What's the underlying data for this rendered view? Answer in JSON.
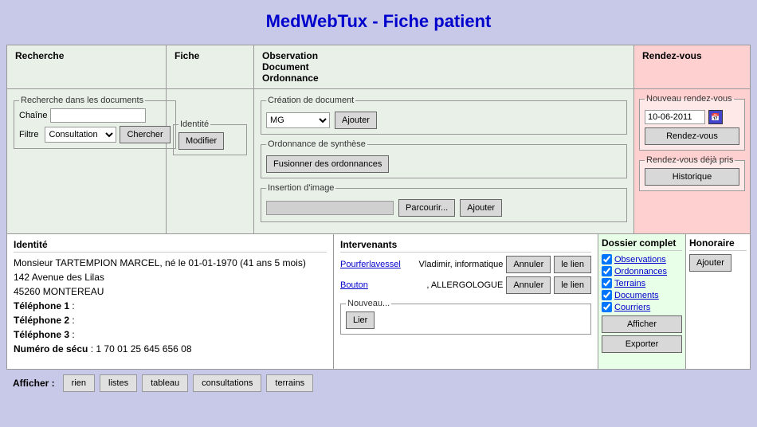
{
  "header": {
    "title": "MedWebTux - Fiche patient"
  },
  "nav": {
    "recherche": "Recherche",
    "fiche": "Fiche",
    "observation": "Observation",
    "document": "Document",
    "ordonnance": "Ordonnance",
    "rendezvous": "Rendez-vous"
  },
  "recherche": {
    "fieldset_label": "Recherche dans les documents",
    "chaine_label": "Chaîne",
    "chaine_value": "",
    "filtre_label": "Filtre",
    "filtre_options": [
      "Consultation"
    ],
    "filtre_selected": "Consultation",
    "chercher_btn": "Chercher"
  },
  "fiche": {
    "identite_label": "Identité",
    "modifier_btn": "Modifier"
  },
  "creation_document": {
    "fieldset_label": "Création de document",
    "type_options": [
      "MG"
    ],
    "type_selected": "MG",
    "ajouter_btn": "Ajouter"
  },
  "ordonnance_synthese": {
    "fieldset_label": "Ordonnance de synthèse",
    "fusionner_btn": "Fusionner des ordonnances"
  },
  "insertion_image": {
    "fieldset_label": "Insertion d'image",
    "path_value": "",
    "parcourir_btn": "Parcourir...",
    "ajouter_btn": "Ajouter"
  },
  "rendez_vous": {
    "nouveau_label": "Nouveau rendez-vous",
    "date_value": "10-06-2011",
    "rdv_btn": "Rendez-vous",
    "deja_pris_label": "Rendez-vous déjà pris",
    "historique_btn": "Historique"
  },
  "patient": {
    "identite_header": "Identité",
    "nom": "Monsieur TARTEMPION MARCEL, né le 01-01-1970 (41 ans 5 mois)",
    "adresse": "142 Avenue des Lilas",
    "ville": "45260 MONTEREAU",
    "tel1_label": "Téléphone 1",
    "tel1_value": "",
    "tel2_label": "Téléphone 2",
    "tel2_value": "",
    "tel3_label": "Téléphone 3",
    "tel3_value": "",
    "secu_label": "Numéro de sécu",
    "secu_value": "1 70 01 25 645 656 08"
  },
  "intervenants": {
    "header": "Intervenants",
    "list": [
      {
        "name": "Pourferlavessel",
        "spec": "Vladimir, informatique",
        "annuler_btn": "Annuler",
        "lien_btn": "le lien"
      },
      {
        "name": "Bouton",
        "spec": ", ALLERGOLOGUE",
        "annuler_btn": "Annuler",
        "lien_btn": "le lien"
      }
    ],
    "nouveau_label": "Nouveau...",
    "lier_btn": "Lier"
  },
  "dossier": {
    "header": "Dossier complet",
    "items": [
      {
        "label": "Observations",
        "checked": true
      },
      {
        "label": "Ordonnances",
        "checked": true
      },
      {
        "label": "Terrains",
        "checked": true
      },
      {
        "label": "Documents",
        "checked": true
      },
      {
        "label": "Courriers",
        "checked": true
      }
    ],
    "afficher_btn": "Afficher",
    "exporter_btn": "Exporter"
  },
  "honoraire": {
    "header": "Honoraire",
    "ajouter_btn": "Ajouter"
  },
  "footer": {
    "afficher_label": "Afficher :",
    "buttons": [
      "rien",
      "listes",
      "tableau",
      "consultations",
      "terrains"
    ]
  }
}
